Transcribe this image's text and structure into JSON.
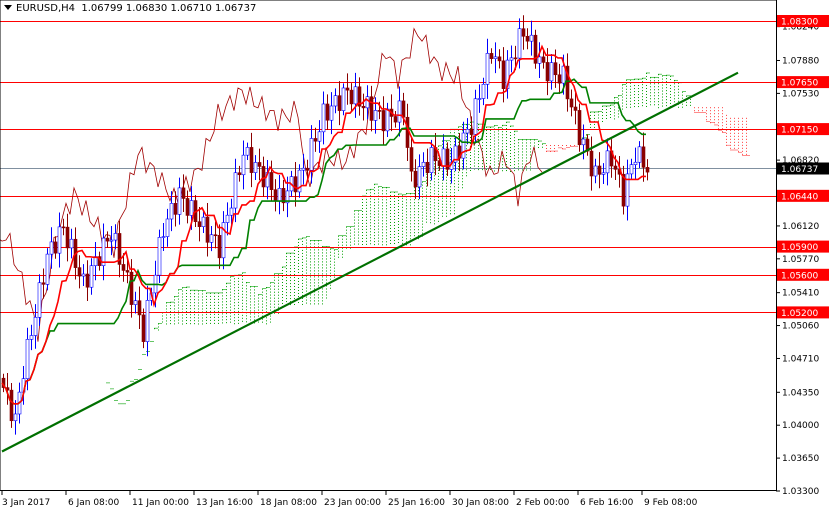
{
  "header": {
    "symbol": "EURUSD,H4",
    "open": "1.06799",
    "high": "1.06830",
    "low": "1.06710",
    "close": "1.06737"
  },
  "chart_data": {
    "type": "candlestick",
    "title": "EURUSD,H4",
    "ylim": [
      1.033,
      1.083
    ],
    "y_ticks": [
      "1.08240",
      "1.07880",
      "1.07530",
      "1.06820",
      "1.06120",
      "1.05770",
      "1.05410",
      "1.05060",
      "1.04710",
      "1.04350",
      "1.04000",
      "1.03650",
      "1.03300"
    ],
    "x_ticks": [
      "3 Jan 2017",
      "6 Jan 08:00",
      "11 Jan 00:00",
      "13 Jan 16:00",
      "18 Jan 08:00",
      "23 Jan 00:00",
      "25 Jan 16:00",
      "30 Jan 08:00",
      "2 Feb 00:00",
      "6 Feb 16:00",
      "9 Feb 08:00"
    ],
    "bars_per_tick": 16,
    "levels": [
      "1.08300",
      "1.07650",
      "1.07150",
      "1.06440",
      "1.05900",
      "1.05600",
      "1.05200"
    ],
    "current_price": "1.06737",
    "price_path": [
      [
        0,
        1.044
      ],
      [
        3,
        1.0405
      ],
      [
        5,
        1.046
      ],
      [
        11,
        1.058
      ],
      [
        15,
        1.061
      ],
      [
        20,
        1.055
      ],
      [
        27,
        1.0605
      ],
      [
        32,
        1.054
      ],
      [
        35,
        1.05
      ],
      [
        40,
        1.061
      ],
      [
        44,
        1.0645
      ],
      [
        50,
        1.061
      ],
      [
        54,
        1.059
      ],
      [
        60,
        1.069
      ],
      [
        65,
        1.0665
      ],
      [
        69,
        1.064
      ],
      [
        72,
        1.0655
      ],
      [
        75,
        1.067
      ],
      [
        80,
        1.073
      ],
      [
        86,
        1.0755
      ],
      [
        95,
        1.0725
      ],
      [
        100,
        1.0735
      ],
      [
        102,
        1.066
      ],
      [
        107,
        1.0685
      ],
      [
        112,
        1.068
      ],
      [
        117,
        1.072
      ],
      [
        122,
        1.08
      ],
      [
        125,
        1.077
      ],
      [
        130,
        1.082
      ],
      [
        135,
        1.078
      ],
      [
        140,
        1.077
      ],
      [
        144,
        1.071
      ],
      [
        148,
        1.0665
      ],
      [
        152,
        1.0685
      ],
      [
        155,
        1.0645
      ],
      [
        158,
        1.069
      ],
      [
        161,
        1.0674
      ]
    ],
    "trendline": [
      [
        0,
        1.0372
      ],
      [
        184,
        1.0775
      ]
    ],
    "colors": {
      "bull": "#0000ff",
      "bear": "#8b0000",
      "tenkan": "#ff0000",
      "kijun": "#008000",
      "chikou": "#a00000",
      "level": "#ff0000",
      "trend": "#007000"
    }
  }
}
